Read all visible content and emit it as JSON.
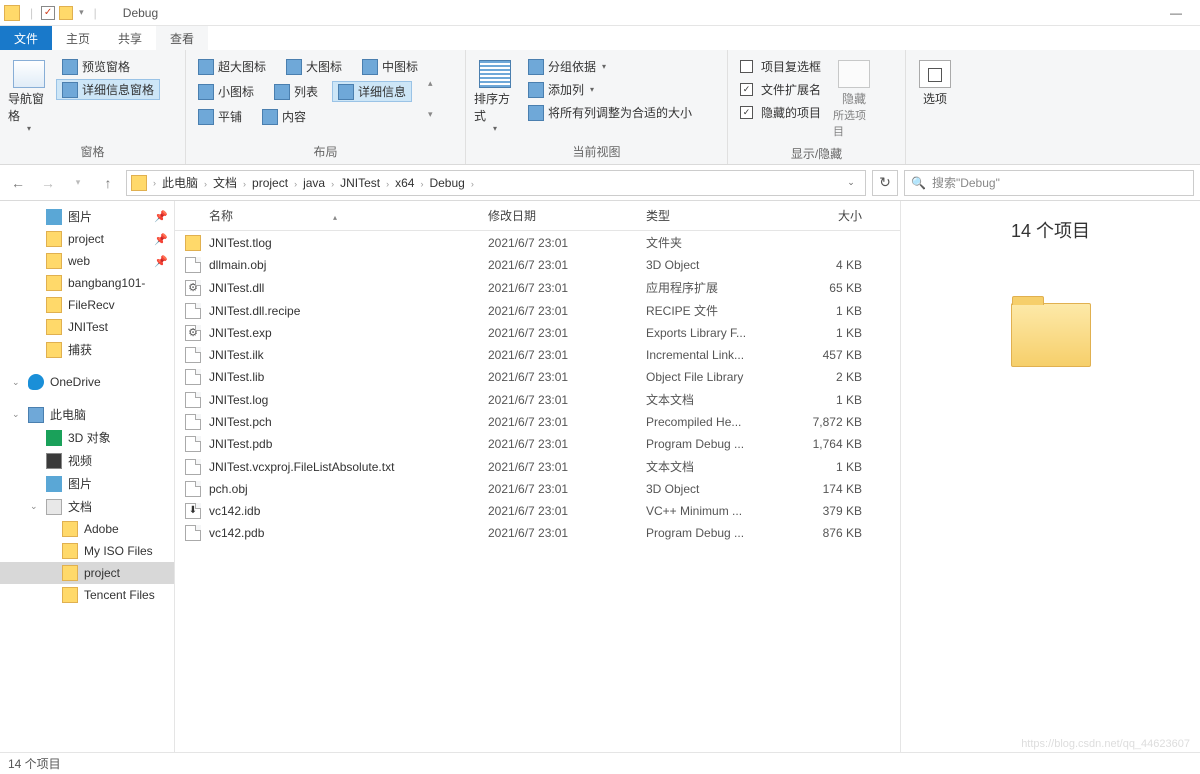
{
  "title": "Debug",
  "tabs": {
    "file": "文件",
    "home": "主页",
    "share": "共享",
    "view": "查看"
  },
  "ribbon": {
    "panes": {
      "nav_pane": "导航窗格",
      "preview_pane": "预览窗格",
      "details_pane": "详细信息窗格",
      "label": "窗格"
    },
    "layout": {
      "xl_icons": "超大图标",
      "l_icons": "大图标",
      "m_icons": "中图标",
      "s_icons": "小图标",
      "list": "列表",
      "details": "详细信息",
      "tiles": "平铺",
      "content": "内容",
      "label": "布局"
    },
    "current_view": {
      "sort": "排序方式",
      "group": "分组依据",
      "add_col": "添加列",
      "fit_cols": "将所有列调整为合适的大小",
      "label": "当前视图"
    },
    "show_hide": {
      "chk_boxes": "项目复选框",
      "ext": "文件扩展名",
      "hidden": "隐藏的项目",
      "hide_btn": "隐藏",
      "hide_sub": "所选项目",
      "label": "显示/隐藏"
    },
    "options": "选项"
  },
  "breadcrumbs": [
    "此电脑",
    "文档",
    "project",
    "java",
    "JNITest",
    "x64",
    "Debug"
  ],
  "search_placeholder": "搜索\"Debug\"",
  "columns": {
    "name": "名称",
    "date": "修改日期",
    "type": "类型",
    "size": "大小"
  },
  "tree": [
    {
      "label": "图片",
      "ico": "pic",
      "pin": true,
      "lvl": 1
    },
    {
      "label": "project",
      "ico": "folder",
      "pin": true,
      "lvl": 1
    },
    {
      "label": "web",
      "ico": "folder",
      "pin": true,
      "lvl": 1
    },
    {
      "label": "bangbang101-",
      "ico": "folder",
      "lvl": 1
    },
    {
      "label": "FileRecv",
      "ico": "folder",
      "lvl": 1
    },
    {
      "label": "JNITest",
      "ico": "folder",
      "lvl": 1
    },
    {
      "label": "捕获",
      "ico": "folder",
      "lvl": 1
    },
    {
      "label": "OneDrive",
      "ico": "onedrive",
      "exp": true,
      "lvl": 0,
      "space": true
    },
    {
      "label": "此电脑",
      "ico": "pc",
      "exp": true,
      "lvl": 0,
      "space": true
    },
    {
      "label": "3D 对象",
      "ico": "obj3d",
      "lvl": 1
    },
    {
      "label": "视频",
      "ico": "vid",
      "lvl": 1
    },
    {
      "label": "图片",
      "ico": "pic",
      "lvl": 1
    },
    {
      "label": "文档",
      "ico": "doc",
      "exp": true,
      "lvl": 1
    },
    {
      "label": "Adobe",
      "ico": "folder",
      "lvl": 2
    },
    {
      "label": "My ISO Files",
      "ico": "folder",
      "lvl": 2
    },
    {
      "label": "project",
      "ico": "folder",
      "lvl": 2,
      "sel": true
    },
    {
      "label": "Tencent Files",
      "ico": "folder",
      "lvl": 2
    }
  ],
  "files": [
    {
      "name": "JNITest.tlog",
      "date": "2021/6/7 23:01",
      "type": "文件夹",
      "size": "",
      "ico": "fldr"
    },
    {
      "name": "dllmain.obj",
      "date": "2021/6/7 23:01",
      "type": "3D Object",
      "size": "4 KB",
      "ico": "file"
    },
    {
      "name": "JNITest.dll",
      "date": "2021/6/7 23:01",
      "type": "应用程序扩展",
      "size": "65 KB",
      "ico": "gear file"
    },
    {
      "name": "JNITest.dll.recipe",
      "date": "2021/6/7 23:01",
      "type": "RECIPE 文件",
      "size": "1 KB",
      "ico": "file"
    },
    {
      "name": "JNITest.exp",
      "date": "2021/6/7 23:01",
      "type": "Exports Library F...",
      "size": "1 KB",
      "ico": "gear file"
    },
    {
      "name": "JNITest.ilk",
      "date": "2021/6/7 23:01",
      "type": "Incremental Link...",
      "size": "457 KB",
      "ico": "file"
    },
    {
      "name": "JNITest.lib",
      "date": "2021/6/7 23:01",
      "type": "Object File Library",
      "size": "2 KB",
      "ico": "file"
    },
    {
      "name": "JNITest.log",
      "date": "2021/6/7 23:01",
      "type": "文本文档",
      "size": "1 KB",
      "ico": "file"
    },
    {
      "name": "JNITest.pch",
      "date": "2021/6/7 23:01",
      "type": "Precompiled He...",
      "size": "7,872 KB",
      "ico": "file"
    },
    {
      "name": "JNITest.pdb",
      "date": "2021/6/7 23:01",
      "type": "Program Debug ...",
      "size": "1,764 KB",
      "ico": "file"
    },
    {
      "name": "JNITest.vcxproj.FileListAbsolute.txt",
      "date": "2021/6/7 23:01",
      "type": "文本文档",
      "size": "1 KB",
      "ico": "file"
    },
    {
      "name": "pch.obj",
      "date": "2021/6/7 23:01",
      "type": "3D Object",
      "size": "174 KB",
      "ico": "file"
    },
    {
      "name": "vc142.idb",
      "date": "2021/6/7 23:01",
      "type": "VC++ Minimum ...",
      "size": "379 KB",
      "ico": "dl file"
    },
    {
      "name": "vc142.pdb",
      "date": "2021/6/7 23:01",
      "type": "Program Debug ...",
      "size": "876 KB",
      "ico": "file"
    }
  ],
  "preview_count": "14 个项目",
  "status": "14 个项目",
  "watermark": "https://blog.csdn.net/qq_44623607"
}
